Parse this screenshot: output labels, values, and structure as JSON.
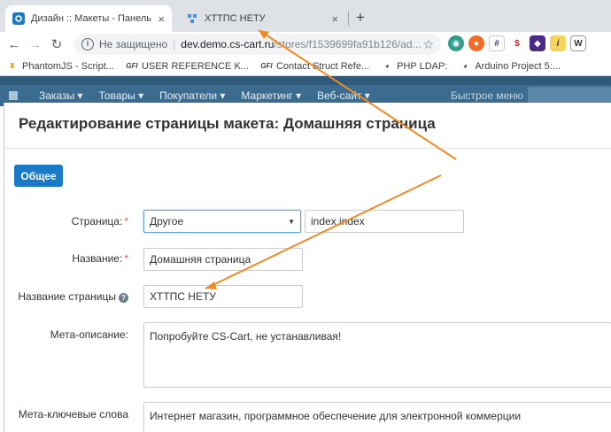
{
  "browser": {
    "tabs": [
      {
        "title": "Дизайн :: Макеты - Панель адм",
        "active": true
      },
      {
        "title": "ХТТПС НЕТУ",
        "active": false
      }
    ],
    "new_tab_label": "+",
    "close_label": "×",
    "address": {
      "security": "Не защищено",
      "host": "dev.demo.cs-cart.ru",
      "path": "/stores/f1539699fa91b126/ad..."
    },
    "extensions": [
      "green-ext",
      "orange-ext",
      "grid-ext",
      "red-ext",
      "purple-ext",
      "info-ext",
      "w-ext"
    ],
    "bookmarks": [
      {
        "label": "PhantomJS - Script..."
      },
      {
        "label": "USER REFERENCE K..."
      },
      {
        "label": "Contact Struct Refe..."
      },
      {
        "label": "PHP LDAP:"
      },
      {
        "label": "Arduino Project 5:..."
      }
    ]
  },
  "admin_menu": {
    "items": [
      "Заказы ▾",
      "Товары ▾",
      "Покупатели ▾",
      "Маркетинг ▾",
      "Веб-сайт ▾"
    ],
    "quick_menu": "Быстрое меню"
  },
  "modal": {
    "title": "Редактирование страницы макета: Домашняя страница",
    "general_button": "Общее",
    "fields": {
      "page_label": "Страница:",
      "page_select_value": "Другое",
      "page_dispatch_value": "index.index",
      "name_label": "Название:",
      "name_value": "Домашняя страница",
      "page_title_label": "Название страницы",
      "page_title_value": "ХТТПС НЕТУ",
      "meta_desc_label": "Мета-описание:",
      "meta_desc_value": "Попробуйте CS-Cart, не устанавливая!",
      "meta_keywords_label": "Мета-ключевые слова",
      "meta_keywords_value": "Интернет магазин, программное обеспечение для электронной коммерции"
    },
    "required_mark": "*",
    "help_mark": "?"
  },
  "colors": {
    "accent": "#1a7ac6",
    "admin_bar": "#3b6b8e",
    "annotation": "#f08a24"
  }
}
